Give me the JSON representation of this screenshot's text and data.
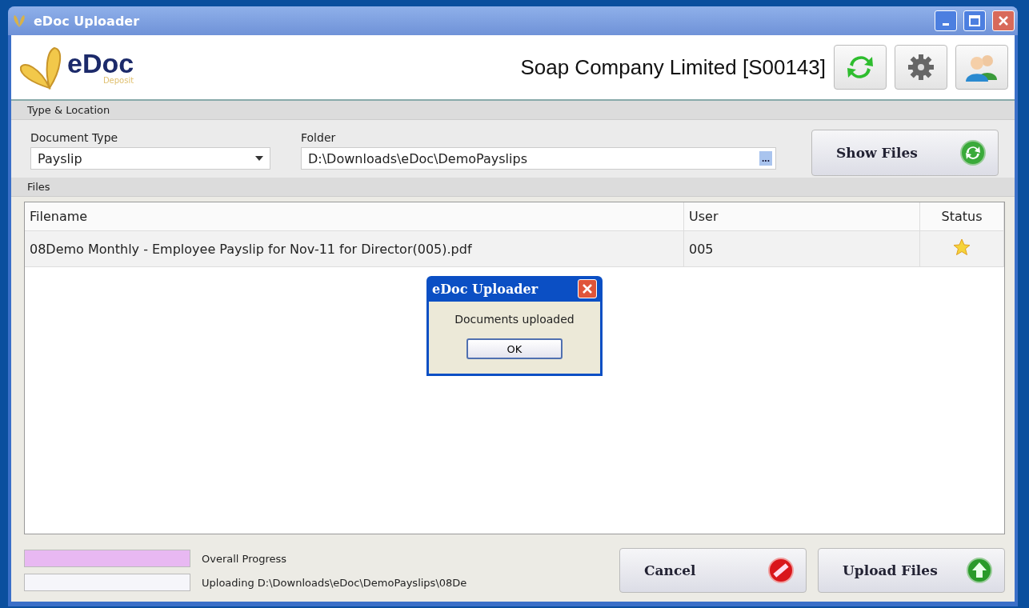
{
  "window": {
    "title": "eDoc Uploader"
  },
  "header": {
    "logo_text": "eDoc",
    "logo_subtext": "Deposit",
    "company": "Soap Company Limited [S00143]"
  },
  "type_location": {
    "title": "Type & Location",
    "document_type": {
      "label": "Document Type",
      "value": "Payslip"
    },
    "folder": {
      "label": "Folder",
      "value": "D:\\Downloads\\eDoc\\DemoPayslips",
      "browse": "..."
    },
    "show_files": "Show Files"
  },
  "files": {
    "title": "Files",
    "columns": [
      "Filename",
      "User",
      "Status"
    ],
    "rows": [
      {
        "filename": "08Demo Monthly - Employee Payslip for Nov-11 for Director(005).pdf",
        "user": "005",
        "starred": true
      }
    ]
  },
  "progress": [
    {
      "level": 1,
      "label": "Overall Progress"
    },
    {
      "level": 0,
      "label": "Uploading D:\\Downloads\\eDoc\\DemoPayslips\\08De"
    }
  ],
  "buttons": [
    {
      "label": "Cancel",
      "kind": "cancel"
    },
    {
      "label": "Upload Files",
      "kind": "upload"
    }
  ],
  "dialog": {
    "title": "eDoc Uploader",
    "message": "Documents uploaded",
    "button": "OK"
  }
}
